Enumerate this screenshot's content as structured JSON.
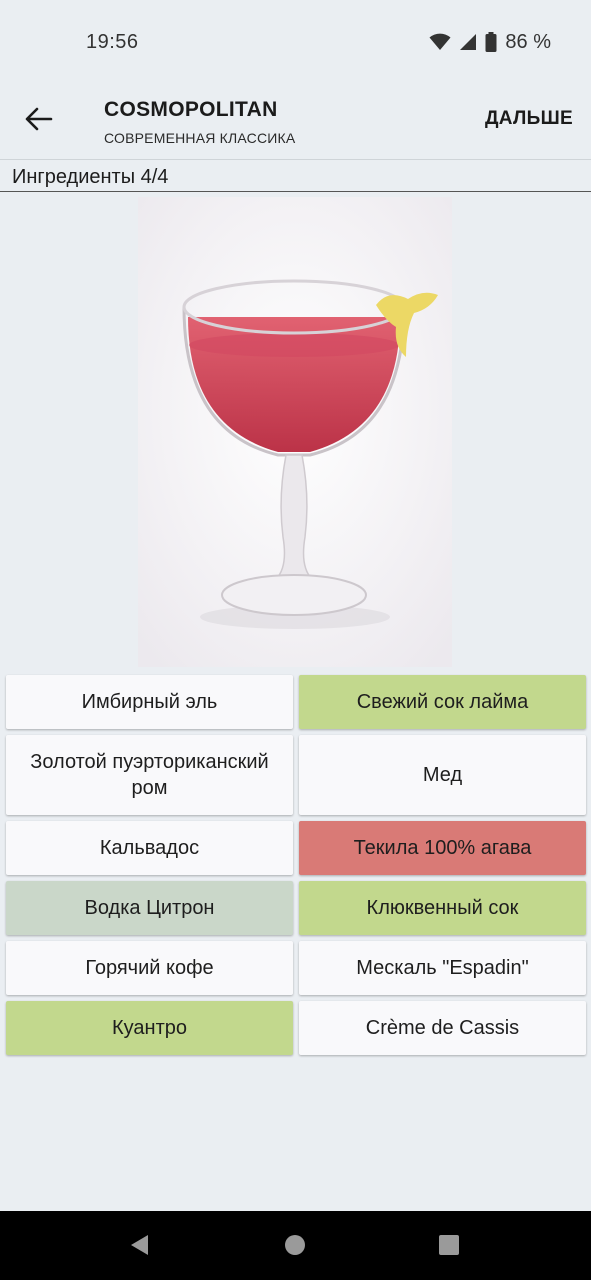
{
  "status_bar": {
    "time": "19:56",
    "battery": "86 %"
  },
  "app_bar": {
    "title": "COSMOPOLITAN",
    "subtitle": "СОВРЕМЕННАЯ КЛАССИКА",
    "next_label": "ДАЛЬШЕ"
  },
  "progress": {
    "label": "Ингредиенты 4/4"
  },
  "colors": {
    "correct": "#c2d88d",
    "wrong": "#d97a76",
    "neutral": "#cad7c9",
    "default": "#f9f9fb"
  },
  "options": [
    {
      "label": "Имбирный эль",
      "state": "default"
    },
    {
      "label": "Свежий сок лайма",
      "state": "correct"
    },
    {
      "label": "Золотой пуэрториканский ром",
      "state": "default"
    },
    {
      "label": "Мед",
      "state": "default"
    },
    {
      "label": "Кальвадос",
      "state": "default"
    },
    {
      "label": "Текила 100% агава",
      "state": "wrong"
    },
    {
      "label": "Водка Цитрон",
      "state": "neutral"
    },
    {
      "label": "Клюквенный сок",
      "state": "correct"
    },
    {
      "label": "Горячий кофе",
      "state": "default"
    },
    {
      "label": "Мескаль \"Espadin\"",
      "state": "default"
    },
    {
      "label": "Куантро",
      "state": "correct"
    },
    {
      "label": "Crème de Cassis",
      "state": "default"
    }
  ],
  "nav": {
    "back_icon": "triangle-back-icon",
    "home_icon": "circle-home-icon",
    "recents_icon": "square-recents-icon"
  }
}
